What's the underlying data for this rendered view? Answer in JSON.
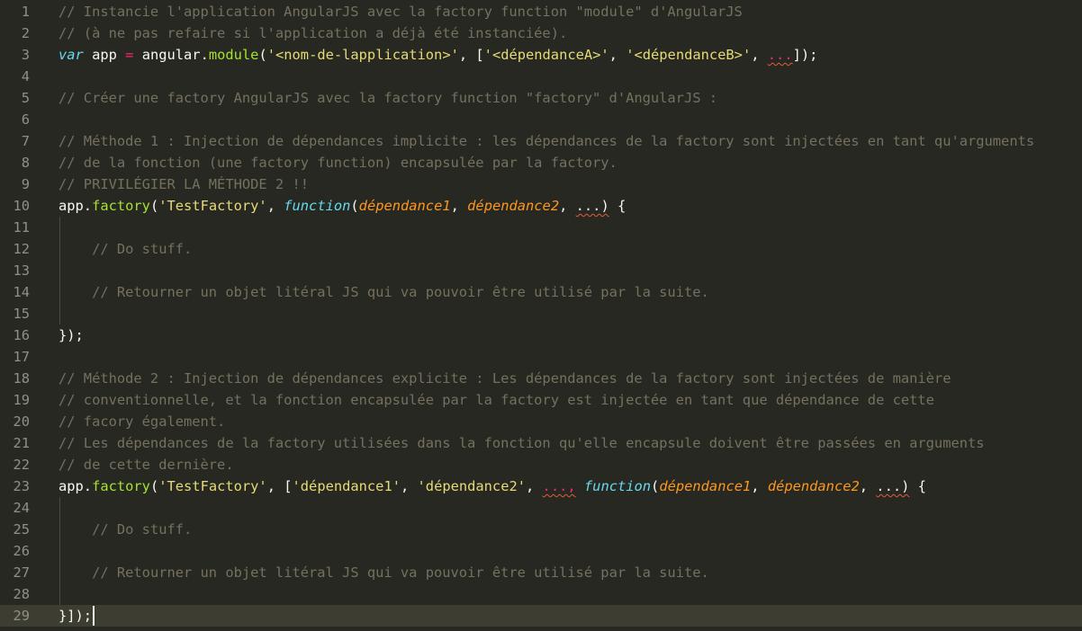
{
  "theme": {
    "background": "#272822",
    "current_line": "#3e3d32",
    "gutter_text": "#90908a",
    "comment": "#75715e",
    "keyword": "#66d9ef",
    "parameter": "#fd971f",
    "string": "#e6db74",
    "function": "#a6e22e",
    "operator": "#f92672",
    "text": "#f8f8f2"
  },
  "editor": {
    "current_line_number": 29,
    "lines": [
      {
        "n": 1,
        "tokens": [
          [
            "c",
            "// Instancie l'application AngularJS avec la factory function \"module\" d'AngularJS"
          ]
        ]
      },
      {
        "n": 2,
        "tokens": [
          [
            "c",
            "// (à ne pas refaire si l'application a déjà été instanciée)."
          ]
        ]
      },
      {
        "n": 3,
        "tokens": [
          [
            "k",
            "var"
          ],
          [
            "t",
            " app "
          ],
          [
            "o",
            "="
          ],
          [
            "t",
            " angular."
          ],
          [
            "f",
            "module"
          ],
          [
            "t",
            "("
          ],
          [
            "s",
            "'<nom-de-lapplication>'"
          ],
          [
            "t",
            ", ["
          ],
          [
            "s",
            "'<dépendanceA>'"
          ],
          [
            "t",
            ", "
          ],
          [
            "s",
            "'<dépendanceB>'"
          ],
          [
            "t",
            ", "
          ],
          [
            "o sq",
            "..."
          ],
          [
            "t",
            "]);"
          ]
        ]
      },
      {
        "n": 4,
        "tokens": []
      },
      {
        "n": 5,
        "tokens": [
          [
            "c",
            "// Créer une factory AngularJS avec la factory function \"factory\" d'AngularJS :"
          ]
        ]
      },
      {
        "n": 6,
        "tokens": []
      },
      {
        "n": 7,
        "tokens": [
          [
            "c",
            "// Méthode 1 : Injection de dépendances implicite : les dépendances de la factory sont injectées en tant qu'arguments"
          ]
        ]
      },
      {
        "n": 8,
        "tokens": [
          [
            "c",
            "// de la fonction (une factory function) encapsulée par la factory."
          ]
        ]
      },
      {
        "n": 9,
        "tokens": [
          [
            "c",
            "// PRIVILÉGIER LA MÉTHODE 2 !!"
          ]
        ]
      },
      {
        "n": 10,
        "tokens": [
          [
            "t",
            "app."
          ],
          [
            "f",
            "factory"
          ],
          [
            "t",
            "("
          ],
          [
            "s",
            "'TestFactory'"
          ],
          [
            "t",
            ", "
          ],
          [
            "k",
            "function"
          ],
          [
            "t",
            "("
          ],
          [
            "p",
            "dépendance1"
          ],
          [
            "t",
            ", "
          ],
          [
            "p",
            "dépendance2"
          ],
          [
            "t",
            ", "
          ],
          [
            "t sq",
            "...)"
          ],
          [
            "t",
            " {"
          ]
        ]
      },
      {
        "n": 11,
        "tokens": []
      },
      {
        "n": 12,
        "tokens": [
          [
            "t",
            "    "
          ],
          [
            "c",
            "// Do stuff."
          ]
        ]
      },
      {
        "n": 13,
        "tokens": []
      },
      {
        "n": 14,
        "tokens": [
          [
            "t",
            "    "
          ],
          [
            "c",
            "// Retourner un objet litéral JS qui va pouvoir être utilisé par la suite."
          ]
        ]
      },
      {
        "n": 15,
        "tokens": []
      },
      {
        "n": 16,
        "tokens": [
          [
            "t",
            "});"
          ]
        ]
      },
      {
        "n": 17,
        "tokens": []
      },
      {
        "n": 18,
        "tokens": [
          [
            "c",
            "// Méthode 2 : Injection de dépendances explicite : Les dépendances de la factory sont injectées de manière"
          ]
        ]
      },
      {
        "n": 19,
        "tokens": [
          [
            "c",
            "// conventionnelle, et la fonction encapsulée par la factory est injectée en tant que dépendance de cette"
          ]
        ]
      },
      {
        "n": 20,
        "tokens": [
          [
            "c",
            "// facory également."
          ]
        ]
      },
      {
        "n": 21,
        "tokens": [
          [
            "c",
            "// Les dépendances de la factory utilisées dans la fonction qu'elle encapsule doivent être passées en arguments"
          ]
        ]
      },
      {
        "n": 22,
        "tokens": [
          [
            "c",
            "// de cette dernière."
          ]
        ]
      },
      {
        "n": 23,
        "tokens": [
          [
            "t",
            "app."
          ],
          [
            "f",
            "factory"
          ],
          [
            "t",
            "("
          ],
          [
            "s",
            "'TestFactory'"
          ],
          [
            "t",
            ", ["
          ],
          [
            "s",
            "'dépendance1'"
          ],
          [
            "t",
            ", "
          ],
          [
            "s",
            "'dépendance2'"
          ],
          [
            "t",
            ", "
          ],
          [
            "o sq",
            "...,"
          ],
          [
            "t",
            " "
          ],
          [
            "k",
            "function"
          ],
          [
            "t",
            "("
          ],
          [
            "p",
            "dépendance1"
          ],
          [
            "t",
            ", "
          ],
          [
            "p",
            "dépendance2"
          ],
          [
            "t",
            ", "
          ],
          [
            "t sq",
            "...)"
          ],
          [
            "t",
            " {"
          ]
        ]
      },
      {
        "n": 24,
        "tokens": []
      },
      {
        "n": 25,
        "tokens": [
          [
            "t",
            "    "
          ],
          [
            "c",
            "// Do stuff."
          ]
        ]
      },
      {
        "n": 26,
        "tokens": []
      },
      {
        "n": 27,
        "tokens": [
          [
            "t",
            "    "
          ],
          [
            "c",
            "// Retourner un objet litéral JS qui va pouvoir être utilisé par la suite."
          ]
        ]
      },
      {
        "n": 28,
        "tokens": []
      },
      {
        "n": 29,
        "tokens": [
          [
            "t",
            "}]);"
          ]
        ]
      }
    ]
  }
}
